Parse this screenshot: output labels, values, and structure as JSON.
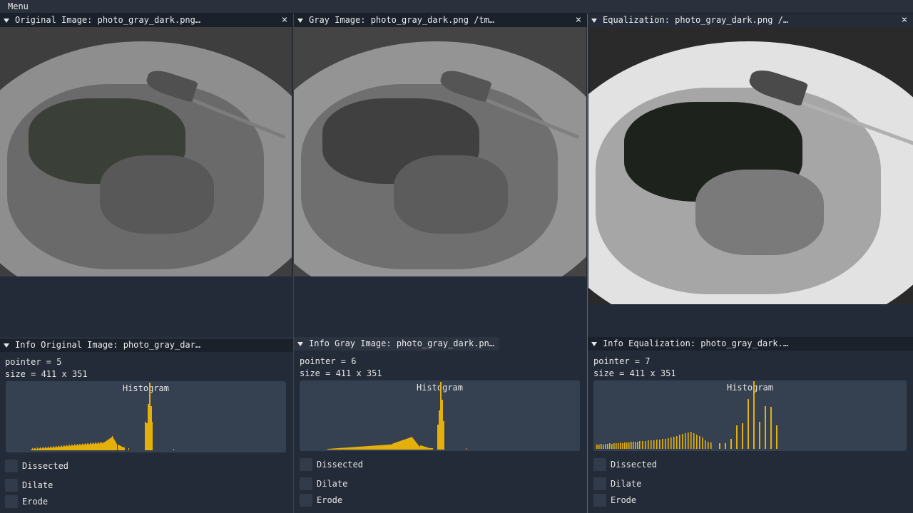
{
  "menubar": {
    "menu_label": "Menu"
  },
  "colors": {
    "accent": "#2f6fb0",
    "histogram_bar": "#e6b00c",
    "histogram_bg": "#354150",
    "window_bg": "#232b38",
    "titlebar_bg": "#1b212b"
  },
  "images": [
    {
      "title": "Original Image: photo_gray_dark.png…"
    },
    {
      "title": "Gray Image: photo_gray_dark.png /tm…"
    },
    {
      "title": "Equalization: photo_gray_dark.png /…"
    }
  ],
  "infos": [
    {
      "title": "Info Original Image: photo_gray_dar…",
      "pointer": "pointer = 5",
      "size": "size = 411 x 351",
      "hist_title": "Histogram",
      "checks": [
        "Dissected",
        "Dilate",
        "Erode"
      ]
    },
    {
      "title": "Info Gray Image: photo_gray_dark.pn…",
      "pointer": "pointer = 6",
      "size": "size = 411 x 351",
      "hist_title": "Histogram",
      "checks": [
        "Dissected",
        "Dilate",
        "Erode"
      ]
    },
    {
      "title": "Info Equalization: photo_gray_dark.…",
      "pointer": "pointer = 7",
      "size": "size = 411 x 351",
      "hist_title": "Histogram",
      "checks": [
        "Dissected",
        "Dilate",
        "Erode"
      ]
    }
  ],
  "close_glyph": "×"
}
